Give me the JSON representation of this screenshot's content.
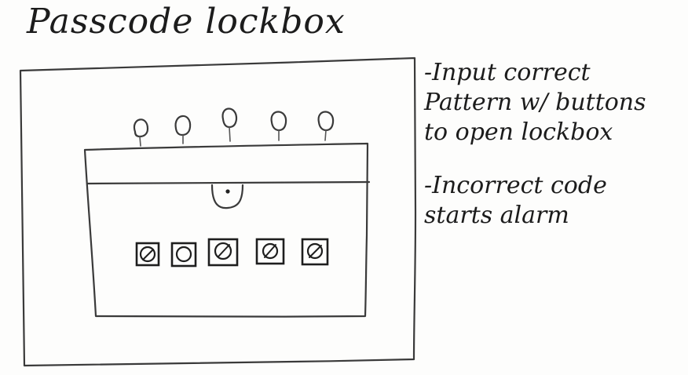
{
  "title": "Passcode lockbox",
  "notes": [
    {
      "lines": [
        "-Input correct",
        "Pattern w/ buttons",
        "to open lockbox"
      ]
    },
    {
      "lines": [
        "-Incorrect code",
        "starts alarm"
      ]
    }
  ],
  "lights": {
    "count": 5
  },
  "buttons": {
    "count": 5
  }
}
